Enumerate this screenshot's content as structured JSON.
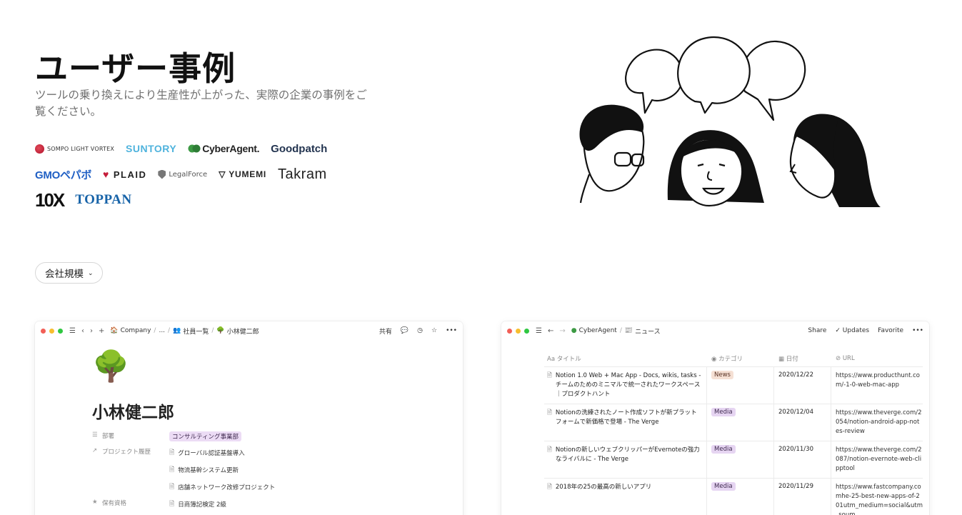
{
  "hero": {
    "title": "ユーザー事例",
    "subtitle": "ツールの乗り換えにより生産性が上がった、実際の企業の事例をご覧ください。"
  },
  "logos": {
    "row1": [
      "SOMPO LIGHT VORTEX",
      "SUNTORY",
      "CyberAgent.",
      "Goodpatch"
    ],
    "row2": [
      "GMOペパボ",
      "PLAID",
      "LegalForce",
      "YUMEMI",
      "Takram"
    ],
    "row3": [
      "10X",
      "TOPPAN"
    ]
  },
  "filter": {
    "label": "会社規模"
  },
  "left_card": {
    "breadcrumb": {
      "company": "Company",
      "ellipsis": "...",
      "list": "社員一覧",
      "person": "小林健二郎"
    },
    "actions": {
      "share": "共有"
    },
    "emoji": "🌳",
    "title": "小林健二郎",
    "props": {
      "dept_key": "部署",
      "dept_value": "コンサルティング事業部",
      "history_key": "プロジェクト履歴",
      "history": [
        "グローバル認証基盤導入",
        "物流基幹システム更新",
        "店舗ネットワーク改修プロジェクト"
      ],
      "cert_key": "保有資格",
      "cert_value": "日商簿記検定 2級"
    }
  },
  "right_card": {
    "breadcrumb": {
      "workspace": "CyberAgent",
      "page": "ニュース"
    },
    "actions": {
      "share": "Share",
      "updates": "Updates",
      "favorite": "Favorite"
    },
    "columns": {
      "title": "タイトル",
      "category": "カテゴリ",
      "date": "日付",
      "url": "URL"
    },
    "rows": [
      {
        "title": "Notion 1.0 Web + Mac App - Docs, wikis, tasks - チームのためのミニマルで統一されたワークスペース｜プロダクトハント",
        "category": "News",
        "date": "2020/12/22",
        "url": "https://www.producthunt.com/-1-0-web-mac-app"
      },
      {
        "title": "Notionの洗練されたノート作成ソフトが新プラットフォームで新価格で登場 - The Verge",
        "category": "Media",
        "date": "2020/12/04",
        "url": "https://www.theverge.com/2054/notion-android-app-notes-review"
      },
      {
        "title": "Notionの新しいウェブクリッパーがEvernoteの強力なライバルに - The Verge",
        "category": "Media",
        "date": "2020/11/30",
        "url": "https://www.theverge.com/2087/notion-evernote-web-clipptool"
      },
      {
        "title": "2018年の25の最高の新しいアプリ",
        "category": "Media",
        "date": "2020/11/29",
        "url": "https://www.fastcompany.comhe-25-best-new-apps-of-201utm_medium=social&utm_soum"
      }
    ]
  }
}
